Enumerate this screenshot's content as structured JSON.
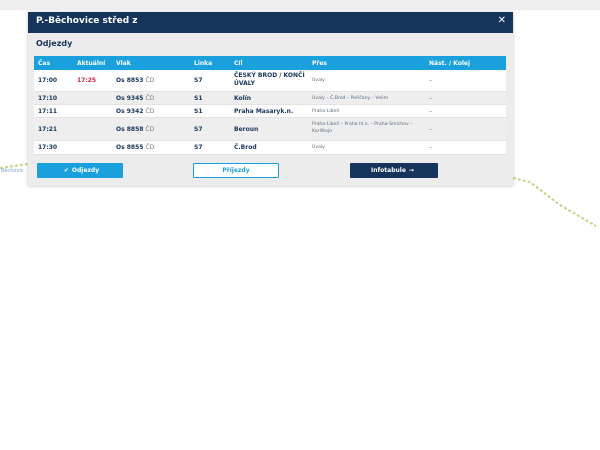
{
  "map": {
    "station_label": "Běchovic"
  },
  "modal": {
    "title": "P.-Běchovice střed z",
    "close_icon": "close-icon",
    "section_title": "Odjezdy"
  },
  "table": {
    "headers": {
      "time": "Čas",
      "actual": "Aktuální",
      "train": "Vlak",
      "line": "Linka",
      "destination": "Cíl",
      "via": "Přes",
      "track": "Nást. / Kolej"
    },
    "rows": [
      {
        "time": "17:00",
        "actual": "17:25",
        "train_no": "Os 8853",
        "operator": "ČD",
        "line": "S7",
        "destination": "ČESKÝ BROD / KONČÍ ÚVALY",
        "via": "Úvaly",
        "track": "–"
      },
      {
        "time": "17:10",
        "actual": "",
        "train_no": "Os 9345",
        "operator": "ČD",
        "line": "S1",
        "destination": "Kolín",
        "via": "Úvaly – Č.Brod – Pořičany – Velim",
        "track": "–"
      },
      {
        "time": "17:11",
        "actual": "",
        "train_no": "Os 9342",
        "operator": "ČD",
        "line": "S1",
        "destination": "Praha Masaryk.n.",
        "via": "Praha-Libeň",
        "track": "–"
      },
      {
        "time": "17:21",
        "actual": "",
        "train_no": "Os 8858",
        "operator": "ČD",
        "line": "S7",
        "destination": "Beroun",
        "via": "Praha-Libeň – Praha hl.n. – Praha-Smíchov – Karlštejn",
        "track": "–"
      },
      {
        "time": "17:30",
        "actual": "",
        "train_no": "Os 8855",
        "operator": "ČD",
        "line": "S7",
        "destination": "Č.Brod",
        "via": "Úvaly",
        "track": "–"
      }
    ]
  },
  "buttons": {
    "departures": "Odjezdy",
    "arrivals": "Příjezdy",
    "infoboard": "Infotabule"
  },
  "colors": {
    "header_bg": "#15355c",
    "table_header_bg": "#1aa0dd",
    "delay_red": "#d0243a",
    "map_line": "#c8d48a"
  }
}
